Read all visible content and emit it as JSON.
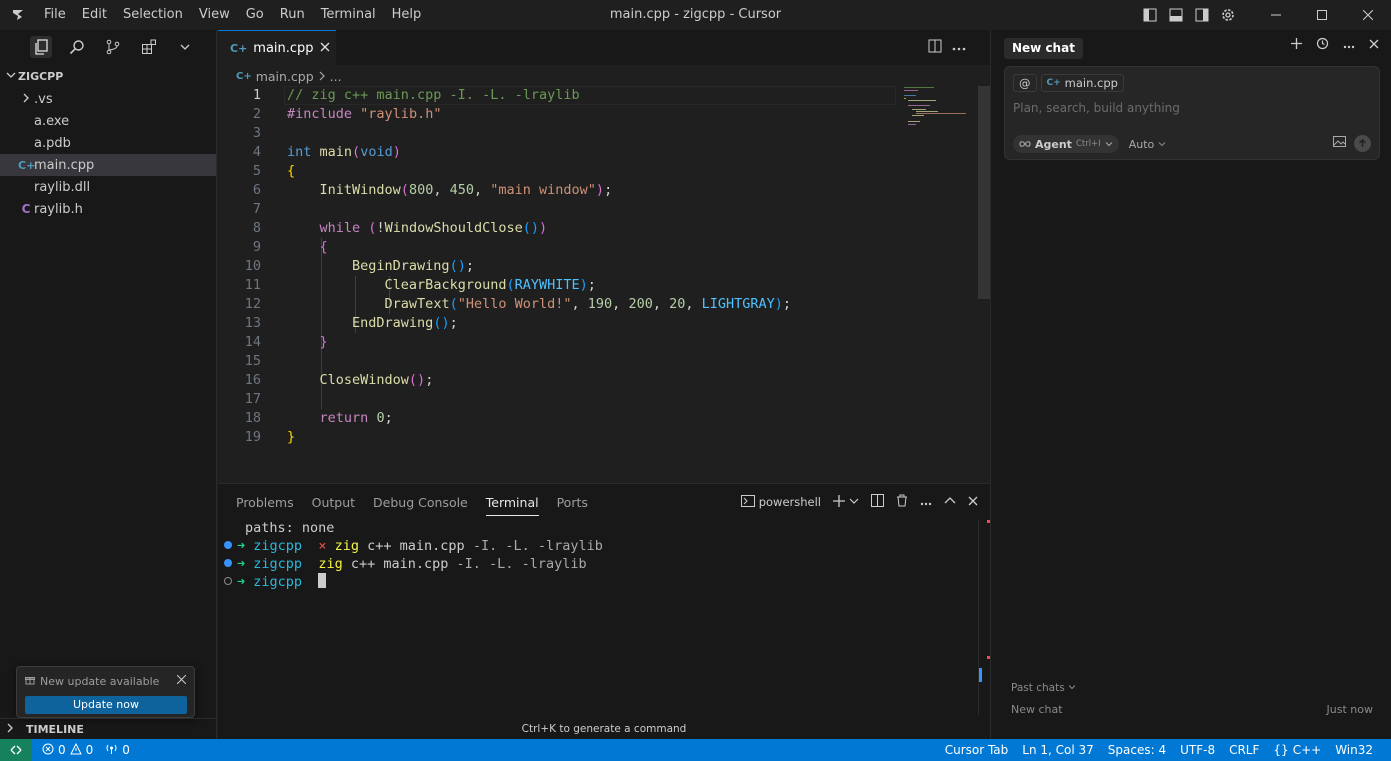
{
  "window": {
    "title": "main.cpp - zigcpp - Cursor",
    "menu": [
      "File",
      "Edit",
      "Selection",
      "View",
      "Go",
      "Run",
      "Terminal",
      "Help"
    ]
  },
  "explorer": {
    "folder": "ZIGCPP",
    "items": [
      {
        "label": ".vs",
        "type": "folder"
      },
      {
        "label": "a.exe",
        "type": "file"
      },
      {
        "label": "a.pdb",
        "type": "file"
      },
      {
        "label": "main.cpp",
        "type": "cpp",
        "selected": true
      },
      {
        "label": "raylib.dll",
        "type": "file"
      },
      {
        "label": "raylib.h",
        "type": "c"
      }
    ],
    "timeline": "TIMELINE"
  },
  "notification": {
    "message": "New update available",
    "button": "Update now"
  },
  "editor": {
    "tab": "main.cpp",
    "breadcrumb_file": "main.cpp",
    "breadcrumb_more": "...",
    "current_line": 1
  },
  "panel": {
    "tabs": [
      "Problems",
      "Output",
      "Debug Console",
      "Terminal",
      "Ports"
    ],
    "active_tab": "Terminal",
    "shell": "powershell",
    "hint": "Ctrl+K to generate a command",
    "terminal": {
      "line1": "paths: none",
      "dir": "zigcpp",
      "cmd": "zig",
      "args": "c++ main.cpp",
      "flags": "-I. -L. -lraylib",
      "x": "×",
      "arrow": "➜"
    }
  },
  "chat": {
    "header": "New chat",
    "context_file": "main.cpp",
    "placeholder": "Plan, search, build anything",
    "agent_label": "Agent",
    "agent_shortcut": "Ctrl+I",
    "model": "Auto",
    "past_chats": "Past chats",
    "past_item": "New chat",
    "past_item_time": "Just now"
  },
  "status": {
    "errors": "0",
    "warnings": "0",
    "ports": "0",
    "cursor_tab": "Cursor Tab",
    "position": "Ln 1, Col 37",
    "spaces": "Spaces: 4",
    "encoding": "UTF-8",
    "eol": "CRLF",
    "language": "C++",
    "platform": "Win32",
    "lang_braces": "{}"
  },
  "colors": {
    "accent": "#0078d4",
    "remote": "#16825d",
    "comment": "#6a9955",
    "string": "#ce9178",
    "keyword": "#569cd6",
    "function": "#dcdcaa",
    "number": "#b5cea8"
  }
}
